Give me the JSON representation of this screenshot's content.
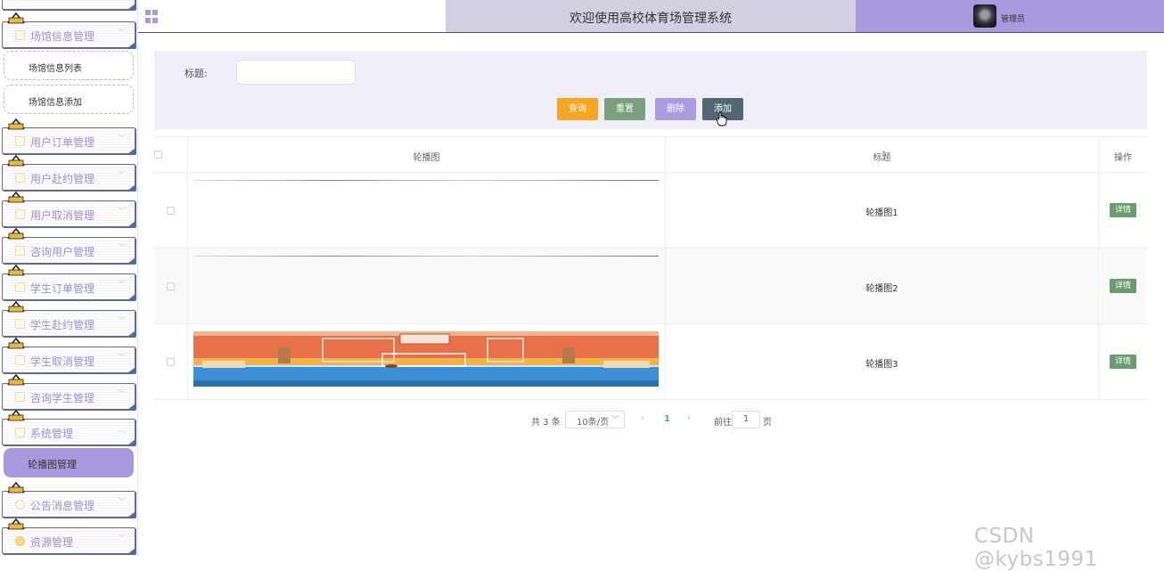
{
  "header": {
    "title": "欢迎使用高校体育场管理系统",
    "user": "管理员"
  },
  "sidebar": {
    "menus": [
      {
        "label": "场馆信息管理",
        "subitems": [
          "场馆信息列表",
          "场馆信息添加"
        ]
      },
      {
        "label": "用户订单管理"
      },
      {
        "label": "用户赴约管理"
      },
      {
        "label": "用户取消管理"
      },
      {
        "label": "咨询用户管理"
      },
      {
        "label": "学生订单管理"
      },
      {
        "label": "学生赴约管理"
      },
      {
        "label": "学生取消管理"
      },
      {
        "label": "咨询学生管理"
      },
      {
        "label": "系统管理"
      },
      {
        "label": "公告消息管理"
      },
      {
        "label": "资源管理"
      }
    ],
    "active_item": "轮播图管理"
  },
  "search": {
    "label": "标题:",
    "value": "",
    "buttons": {
      "query": "查询",
      "reset": "重置",
      "delete": "删除",
      "add": "添加"
    }
  },
  "table": {
    "columns": [
      "轮播图",
      "标题",
      "操作"
    ],
    "rows": [
      {
        "title": "轮播图1",
        "action": "详情"
      },
      {
        "title": "轮播图2",
        "action": "详情"
      },
      {
        "title": "轮播图3",
        "action": "详情"
      }
    ]
  },
  "pagination": {
    "total": "共 3 条",
    "page_size": "10条/页",
    "current_page": "1",
    "goto_label": "前往",
    "goto_value": "1",
    "page_suffix": "页"
  },
  "watermark": "CSDN @kybs1991",
  "colors": {
    "accent": "#a99ae0",
    "query": "#f5a623",
    "reset": "#7aa07d",
    "add": "#536673",
    "detail": "#6a9c6f"
  }
}
